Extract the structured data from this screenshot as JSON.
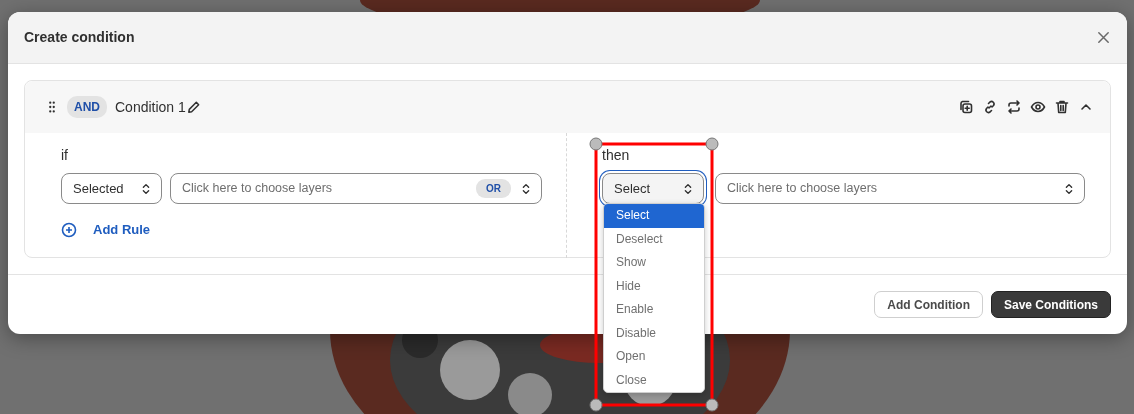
{
  "dialog": {
    "title": "Create condition"
  },
  "conditions": [
    {
      "operator": "AND",
      "name": "Condition 1",
      "expanded": true,
      "if": {
        "label": "if",
        "rules": [
          {
            "trigger": "Selected",
            "layers_placeholder": "Click here to choose layers",
            "joiner": "OR"
          }
        ],
        "add_rule": "Add Rule"
      },
      "then": {
        "label": "then",
        "action": "Select",
        "focused": true,
        "layers_placeholder": "Click here to choose layers",
        "menu_open": true,
        "action_menu": [
          {
            "label": "Select",
            "selected": true
          },
          {
            "label": "Deselect",
            "selected": false
          },
          {
            "label": "Show",
            "selected": false
          },
          {
            "label": "Hide",
            "selected": false
          },
          {
            "label": "Enable",
            "selected": false
          },
          {
            "label": "Disable",
            "selected": false
          },
          {
            "label": "Open",
            "selected": false
          },
          {
            "label": "Close",
            "selected": false
          }
        ]
      }
    }
  ],
  "buttons": [
    {
      "label": "Add Condition",
      "kind": "secondary"
    },
    {
      "label": "Save Conditions",
      "kind": "primary"
    }
  ]
}
